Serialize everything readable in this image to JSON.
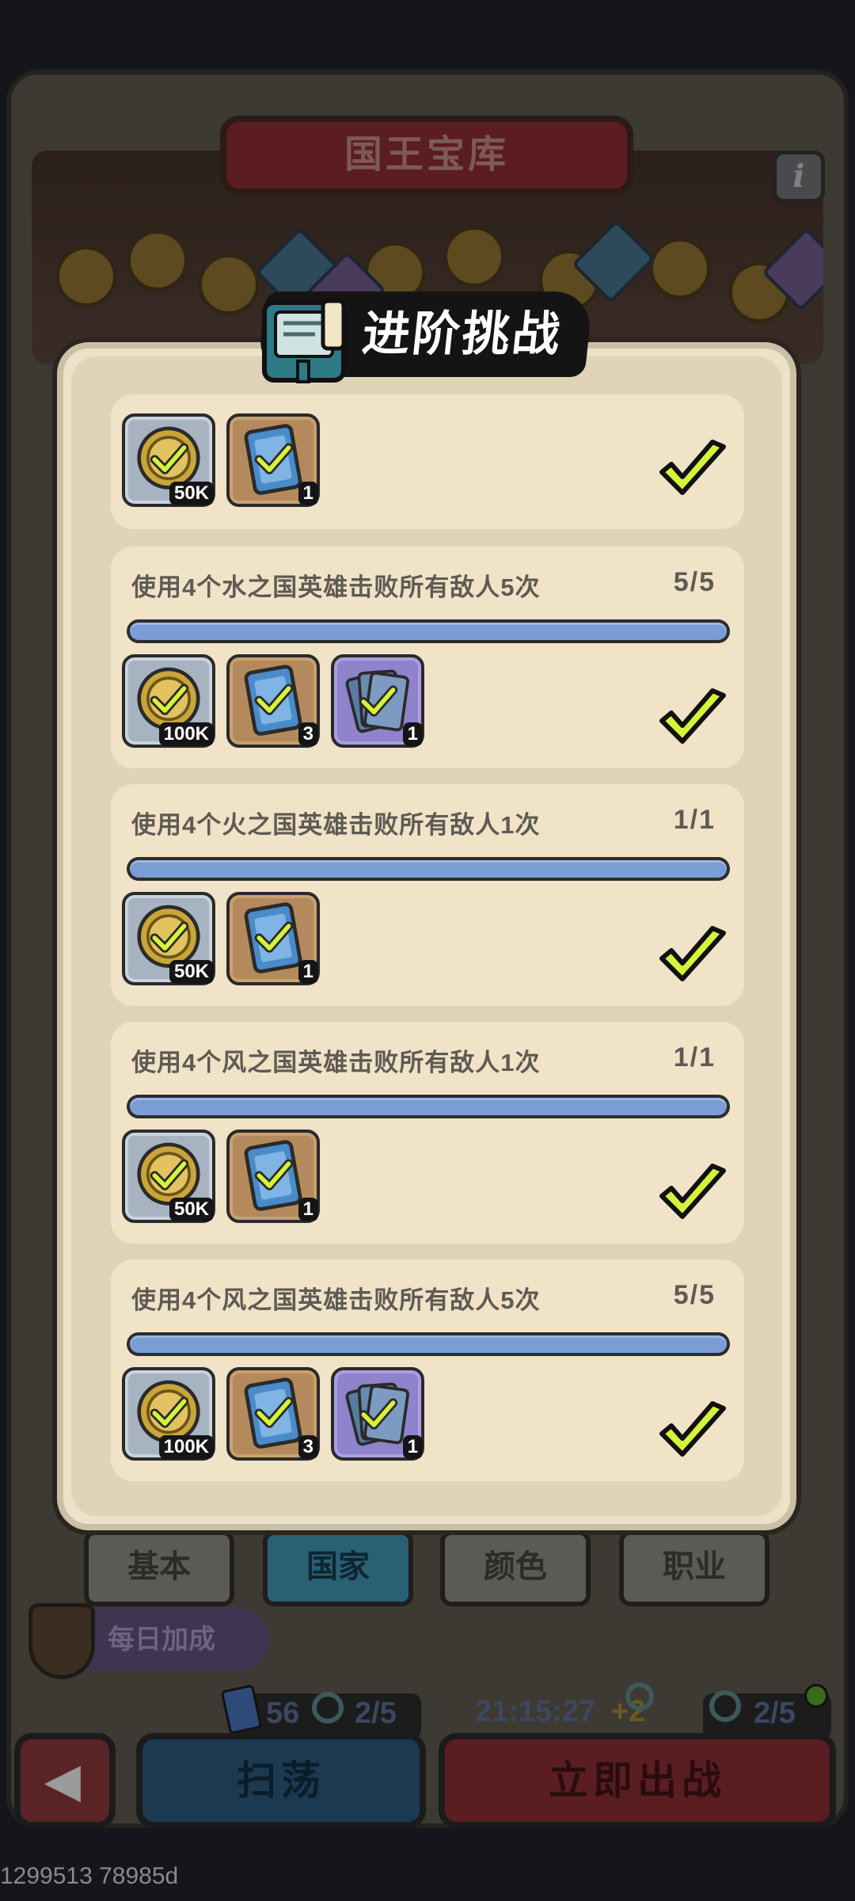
{
  "screen_title": "国王宝库",
  "info_label": "i",
  "modal": {
    "title": "进阶挑战",
    "tasks": [
      {
        "desc": "",
        "progress": "",
        "progress_fraction": 1.0,
        "rewards": [
          {
            "type": "coin",
            "count": "50K"
          },
          {
            "type": "card",
            "count": "1"
          }
        ],
        "completed": true
      },
      {
        "desc": "使用4个水之国英雄击败所有敌人5次",
        "progress": "5/5",
        "progress_fraction": 1.0,
        "rewards": [
          {
            "type": "coin",
            "count": "100K"
          },
          {
            "type": "card",
            "count": "3"
          },
          {
            "type": "pack",
            "count": "1"
          }
        ],
        "completed": true
      },
      {
        "desc": "使用4个火之国英雄击败所有敌人1次",
        "progress": "1/1",
        "progress_fraction": 1.0,
        "rewards": [
          {
            "type": "coin",
            "count": "50K"
          },
          {
            "type": "card",
            "count": "1"
          }
        ],
        "completed": true
      },
      {
        "desc": "使用4个风之国英雄击败所有敌人1次",
        "progress": "1/1",
        "progress_fraction": 1.0,
        "rewards": [
          {
            "type": "coin",
            "count": "50K"
          },
          {
            "type": "card",
            "count": "1"
          }
        ],
        "completed": true
      },
      {
        "desc": "使用4个风之国英雄击败所有敌人5次",
        "progress": "5/5",
        "progress_fraction": 1.0,
        "rewards": [
          {
            "type": "coin",
            "count": "100K"
          },
          {
            "type": "card",
            "count": "3"
          },
          {
            "type": "pack",
            "count": "1"
          }
        ],
        "completed": true
      }
    ]
  },
  "tabs": [
    "基本",
    "国家",
    "颜色",
    "职业"
  ],
  "active_tab": "国家",
  "daily_bonus": "每日加成",
  "stats": {
    "cards": "56",
    "keys_left": "2/5",
    "timer": "21:15:27",
    "timer_plus": "+2",
    "keys_right": "2/5"
  },
  "buttons": {
    "back": "",
    "sweep": "扫荡",
    "battle": "立即出战"
  },
  "footer_id": "1299513 78985d",
  "colors": {
    "progress_fill": "#7b9dd6",
    "check": "#d6f33c",
    "modal_bg": "#ece1c9",
    "title_bg": "#141414"
  }
}
